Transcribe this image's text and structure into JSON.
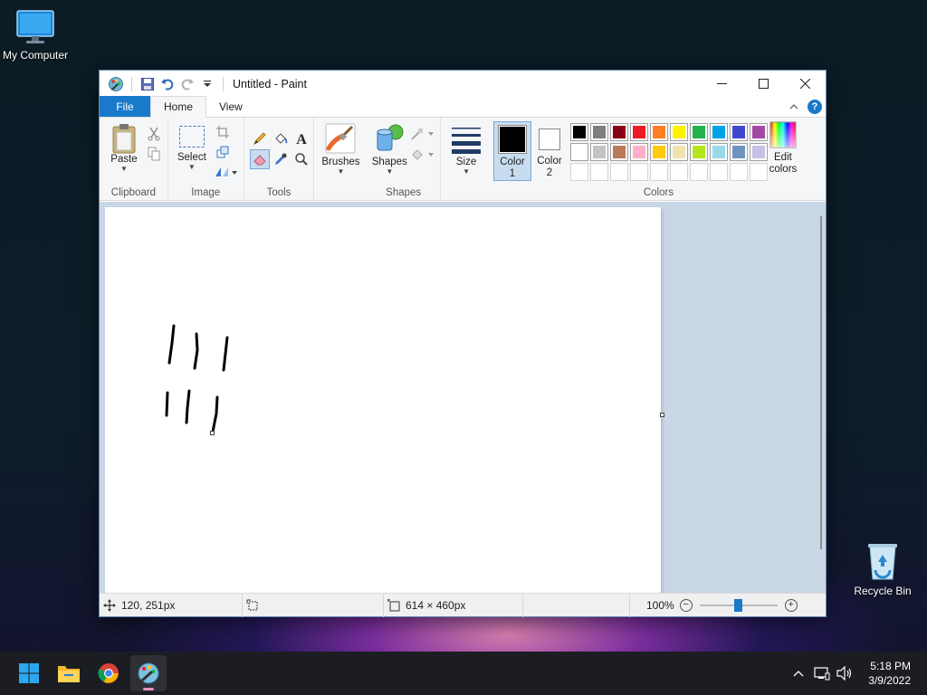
{
  "desktop": {
    "icons": [
      {
        "label": "My Computer"
      },
      {
        "label": "Recycle Bin"
      }
    ]
  },
  "window": {
    "title": "Untitled - Paint",
    "tabs": {
      "file": "File",
      "home": "Home",
      "view": "View"
    },
    "ribbon": {
      "clipboard": {
        "group_label": "Clipboard",
        "paste": "Paste"
      },
      "image": {
        "group_label": "Image",
        "select": "Select"
      },
      "tools": {
        "group_label": "Tools"
      },
      "brushes": {
        "label": "Brushes"
      },
      "shapes": {
        "group_label": "Shapes",
        "label": "Shapes"
      },
      "size": {
        "label": "Size"
      },
      "colors": {
        "group_label": "Colors",
        "color1": "Color",
        "color1_num": "1",
        "color2": "Color",
        "color2_num": "2",
        "edit": "Edit",
        "edit2": "colors",
        "color1_value": "#000000",
        "color2_value": "#ffffff",
        "palette_row1": [
          "#000000",
          "#7f7f7f",
          "#880015",
          "#ed1c24",
          "#ff7f27",
          "#fff200",
          "#22b14c",
          "#00a2e8",
          "#3f48cc",
          "#a349a4"
        ],
        "palette_row2": [
          "#ffffff",
          "#c3c3c3",
          "#b97a57",
          "#ffaec9",
          "#ffc90e",
          "#efe4b0",
          "#b5e61d",
          "#99d9ea",
          "#7092be",
          "#c8bfe7"
        ]
      }
    },
    "status": {
      "cursor_pos": "120, 251px",
      "canvas_size": "614 × 460px",
      "zoom": "100%",
      "zoom_level_fraction": 0.5
    }
  },
  "taskbar": {
    "time": "5:18 PM",
    "date": "3/9/2022"
  }
}
